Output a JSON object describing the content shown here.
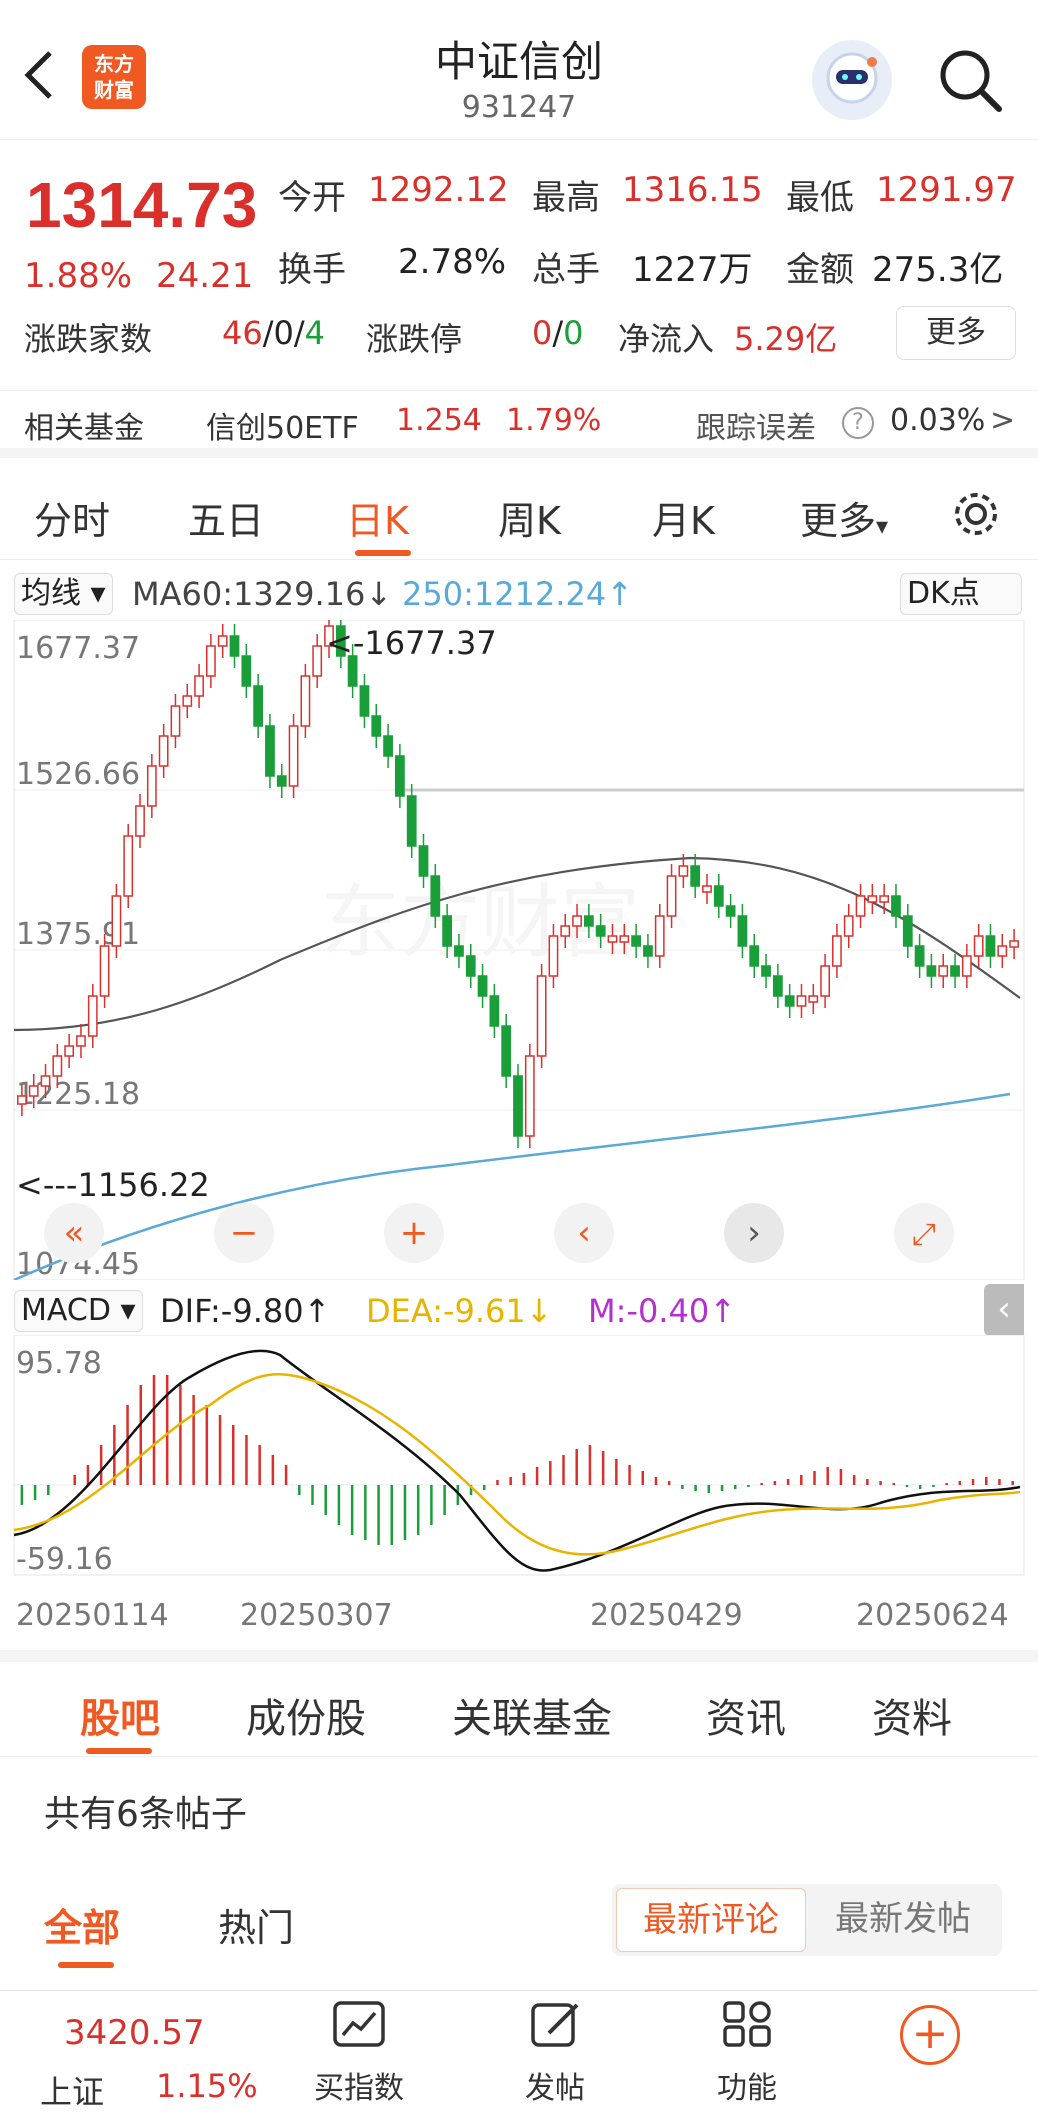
{
  "header": {
    "logo_text": "东方财富",
    "title": "中证信创",
    "code": "931247"
  },
  "quote": {
    "price": "1314.73",
    "change_pct": "1.88%",
    "change_abs": "24.21",
    "open_label": "今开",
    "open": "1292.12",
    "high_label": "最高",
    "high": "1316.15",
    "low_label": "最低",
    "low": "1291.97",
    "turnover_label": "换手",
    "turnover": "2.78%",
    "volume_label": "总手",
    "volume": "1227万",
    "amount_label": "金额",
    "amount": "275.3亿",
    "breadth_label": "涨跌家数",
    "breadth_up": "46",
    "breadth_flat": "/0/",
    "breadth_down": "4",
    "limit_label": "涨跌停",
    "limit_up": "0",
    "limit_sep": "/",
    "limit_down": "0",
    "inflow_label": "净流入",
    "inflow": "5.29亿",
    "more": "更多"
  },
  "fund": {
    "label": "相关基金",
    "name": "信创50ETF",
    "price": "1.254",
    "pct": "1.79%",
    "err_label": "跟踪误差",
    "err": "0.03%",
    "arrow": ">"
  },
  "tabs": [
    "分时",
    "五日",
    "日K",
    "周K",
    "月K",
    "更多"
  ],
  "tab_more_arrow": "▾",
  "indicators": {
    "ma_dropdown": "均线",
    "ma60": "MA60:1329.16↓",
    "ma250": "250:1212.24↑",
    "dk": "DK点",
    "macd_dropdown": "MACD",
    "dif": "DIF:-9.80↑",
    "dea": "DEA:-9.61↓",
    "m": "M:-0.40↑"
  },
  "kchart": {
    "y_labels": [
      "1677.37",
      "1526.66",
      "1375.91",
      "1225.18",
      "1074.45"
    ],
    "high_note": "<-1677.37",
    "low_note": "<---1156.22",
    "watermark": "东方财富",
    "nav_buttons": [
      "«",
      "−",
      "+",
      "‹",
      "›",
      "⤢"
    ]
  },
  "macd_chart": {
    "y_top": "95.78",
    "y_bottom": "-59.16",
    "x_labels": [
      "20250114",
      "20250307",
      "20250429",
      "20250624"
    ]
  },
  "bottom_tabs": [
    "股吧",
    "成份股",
    "关联基金",
    "资讯",
    "资料"
  ],
  "posts": {
    "count_text": "共有6条帖子",
    "filter_all": "全部",
    "filter_hot": "热门",
    "sort_comment": "最新评论",
    "sort_post": "最新发帖"
  },
  "bottombar": {
    "index_value": "3420.57",
    "index_name": "上证",
    "index_pct": "1.15%",
    "items": [
      "买指数",
      "发帖",
      "功能"
    ]
  },
  "colors": {
    "accent": "#f05a22",
    "up": "#d9302c",
    "down": "#1a9e3a",
    "ma60": "#555555",
    "ma250": "#5aa9d6",
    "dea": "#e8b400",
    "m": "#b42fd0"
  }
}
